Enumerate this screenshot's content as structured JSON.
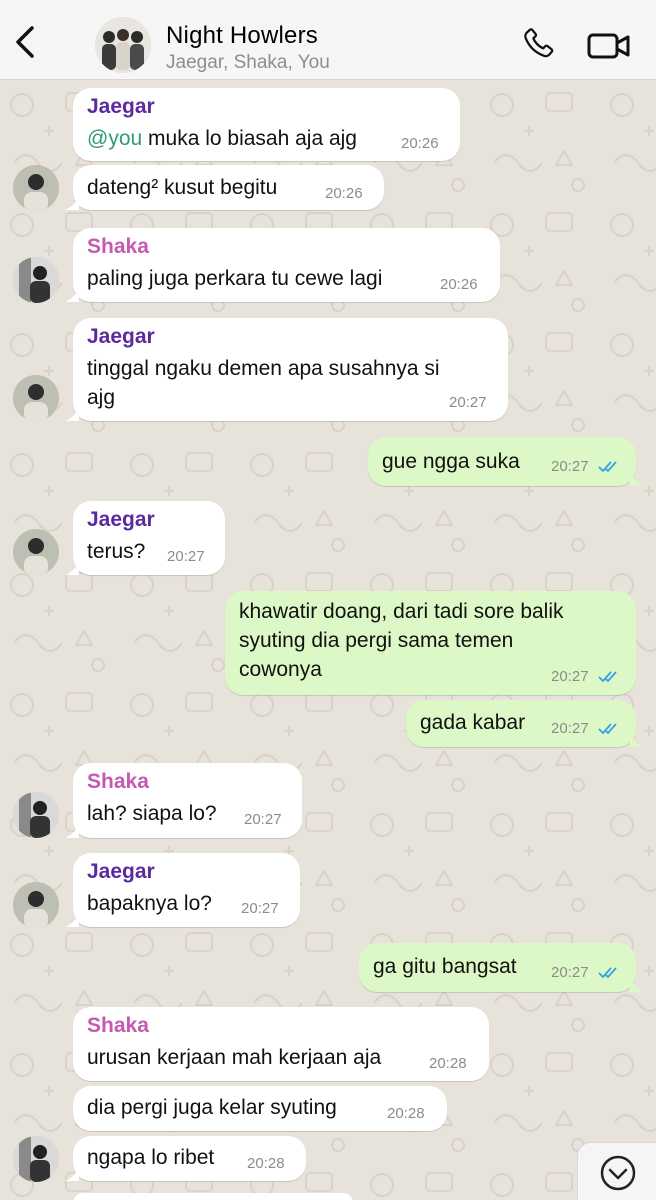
{
  "header": {
    "title": "Night Howlers",
    "subtitle": "Jaegar, Shaka, You"
  },
  "messages": [
    {
      "sender": "Jaegar",
      "mention": "@you",
      "text": " muka lo biasah aja ajg",
      "time": "20:26"
    },
    {
      "text": "dateng² kusut begitu",
      "time": "20:26"
    },
    {
      "sender": "Shaka",
      "text": "paling juga perkara tu cewe lagi",
      "time": "20:26"
    },
    {
      "sender": "Jaegar",
      "line1": "tinggal ngaku demen apa susahnya si",
      "line2": "ajg",
      "time": "20:27"
    },
    {
      "text": "gue ngga suka",
      "time": "20:27"
    },
    {
      "sender": "Jaegar",
      "text": "terus?",
      "time": "20:27"
    },
    {
      "line1": "khawatir doang, dari tadi sore balik",
      "line2": "syuting dia pergi sama temen",
      "line3": "cowonya",
      "time": "20:27"
    },
    {
      "text": "gada kabar",
      "time": "20:27"
    },
    {
      "sender": "Shaka",
      "text": "lah? siapa lo?",
      "time": "20:27"
    },
    {
      "sender": "Jaegar",
      "text": "bapaknya lo?",
      "time": "20:27"
    },
    {
      "text": "ga gitu bangsat",
      "time": "20:27"
    },
    {
      "sender": "Shaka",
      "text": "urusan kerjaan mah kerjaan aja",
      "time": "20:28"
    },
    {
      "text": "dia pergi juga kelar syuting",
      "time": "20:28"
    },
    {
      "text": "ngapa lo ribet",
      "time": "20:28"
    }
  ],
  "colors": {
    "outgoing_bubble": "#dcf8c6",
    "incoming_bubble": "#ffffff",
    "jaegar_name": "#5b2a9e",
    "shaka_name": "#c45ab1",
    "read_ticks": "#34a0e8"
  },
  "icons": {
    "back": "chevron-left-icon",
    "call": "phone-icon",
    "video": "video-camera-icon",
    "scroll": "chevron-down-icon",
    "ticks": "double-check-icon"
  }
}
